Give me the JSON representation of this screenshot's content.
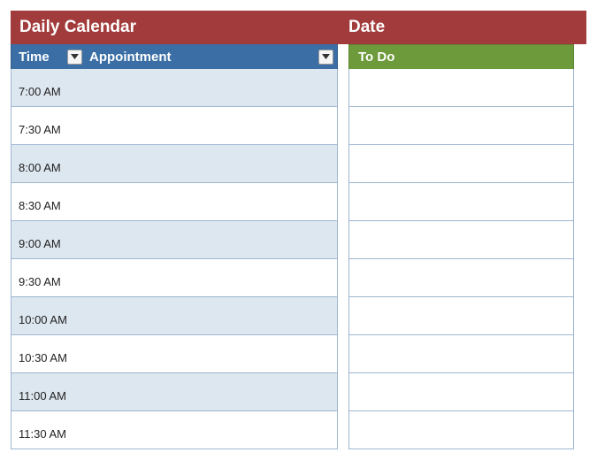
{
  "header": {
    "title_left": "Daily Calendar",
    "title_right": "Date"
  },
  "columns": {
    "time_label": "Time",
    "appointment_label": "Appointment",
    "todo_label": "To Do"
  },
  "time_slots": [
    "7:00 AM",
    "7:30 AM",
    "8:00 AM",
    "8:30 AM",
    "9:00 AM",
    "9:30 AM",
    "10:00 AM",
    "10:30 AM",
    "11:00 AM",
    "11:30 AM"
  ],
  "todo_items": [
    "",
    "",
    "",
    "",
    "",
    "",
    "",
    "",
    "",
    ""
  ]
}
